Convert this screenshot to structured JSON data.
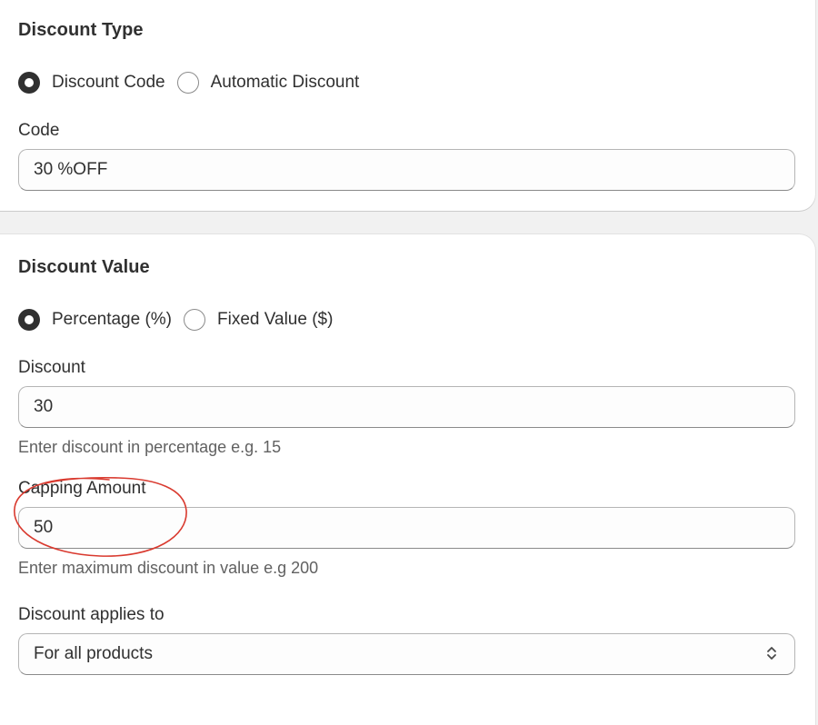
{
  "discount_type": {
    "title": "Discount Type",
    "options": [
      {
        "label": "Discount Code",
        "selected": true
      },
      {
        "label": "Automatic Discount",
        "selected": false
      }
    ],
    "code_label": "Code",
    "code_value": "30 %OFF"
  },
  "discount_value": {
    "title": "Discount Value",
    "options": [
      {
        "label": "Percentage (%)",
        "selected": true
      },
      {
        "label": "Fixed Value ($)",
        "selected": false
      }
    ],
    "discount_label": "Discount",
    "discount_value": "30",
    "discount_help": "Enter discount in percentage e.g. 15",
    "capping_label": "Capping Amount",
    "capping_value": "50",
    "capping_help": "Enter maximum discount in value e.g 200",
    "applies_label": "Discount applies to",
    "applies_value": "For all products"
  },
  "icons": {
    "select_chevron": "chevron-up-down-icon"
  },
  "colors": {
    "annotation": "#d93a2f",
    "text": "#303030",
    "help_text": "#616161",
    "page_background": "#f1f1f1"
  }
}
